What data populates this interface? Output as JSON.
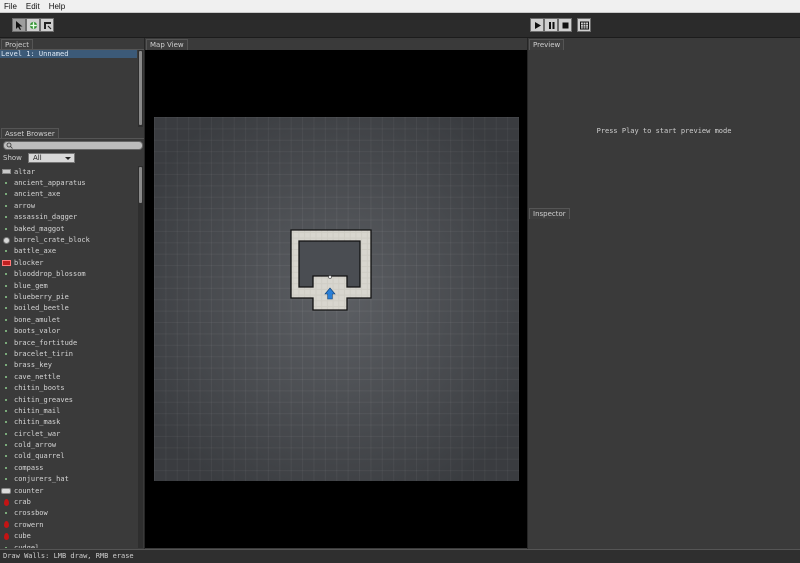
{
  "menu": [
    "File",
    "Edit",
    "Help"
  ],
  "toolbar": {
    "left_tools": [
      "select-tool",
      "add-tool",
      "draw-walls-tool"
    ],
    "playback": [
      "play",
      "pause",
      "stop",
      "export"
    ]
  },
  "project": {
    "tab_label": "Project",
    "items": [
      "Level 1: Unnamed"
    ]
  },
  "asset_browser": {
    "tab_label": "Asset Browser",
    "show_label": "Show",
    "show_value": "All",
    "items": [
      {
        "label": "altar",
        "icon": "flag-icon"
      },
      {
        "label": "ancient_apparatus",
        "icon": "dot-icon"
      },
      {
        "label": "ancient_axe",
        "icon": "dot-icon"
      },
      {
        "label": "arrow",
        "icon": "dot-icon"
      },
      {
        "label": "assassin_dagger",
        "icon": "dot-icon"
      },
      {
        "label": "baked_maggot",
        "icon": "dot-icon"
      },
      {
        "label": "barrel_crate_block",
        "icon": "crate-icon"
      },
      {
        "label": "battle_axe",
        "icon": "dot-icon"
      },
      {
        "label": "blocker",
        "icon": "blocker-icon"
      },
      {
        "label": "blooddrop_blossom",
        "icon": "dot-icon"
      },
      {
        "label": "blue_gem",
        "icon": "dot-icon"
      },
      {
        "label": "blueberry_pie",
        "icon": "dot-icon"
      },
      {
        "label": "boiled_beetle",
        "icon": "dot-icon"
      },
      {
        "label": "bone_amulet",
        "icon": "dot-icon"
      },
      {
        "label": "boots_valor",
        "icon": "dot-icon"
      },
      {
        "label": "brace_fortitude",
        "icon": "dot-icon"
      },
      {
        "label": "bracelet_tirin",
        "icon": "dot-icon"
      },
      {
        "label": "brass_key",
        "icon": "dot-icon"
      },
      {
        "label": "cave_nettle",
        "icon": "dot-icon"
      },
      {
        "label": "chitin_boots",
        "icon": "dot-icon"
      },
      {
        "label": "chitin_greaves",
        "icon": "dot-icon"
      },
      {
        "label": "chitin_mail",
        "icon": "dot-icon"
      },
      {
        "label": "chitin_mask",
        "icon": "dot-icon"
      },
      {
        "label": "circlet_war",
        "icon": "dot-icon"
      },
      {
        "label": "cold_arrow",
        "icon": "dot-icon"
      },
      {
        "label": "cold_quarrel",
        "icon": "dot-icon"
      },
      {
        "label": "compass",
        "icon": "dot-icon"
      },
      {
        "label": "conjurers_hat",
        "icon": "dot-icon"
      },
      {
        "label": "counter",
        "icon": "counter-icon"
      },
      {
        "label": "crab",
        "icon": "drop-icon"
      },
      {
        "label": "crossbow",
        "icon": "dot-icon"
      },
      {
        "label": "crowern",
        "icon": "drop-icon"
      },
      {
        "label": "cube",
        "icon": "drop-icon"
      },
      {
        "label": "cudgel",
        "icon": "dot-icon"
      }
    ]
  },
  "map_view": {
    "tab_label": "Map View"
  },
  "preview": {
    "tab_label": "Preview",
    "message": "Press Play to start preview mode"
  },
  "inspector": {
    "tab_label": "Inspector"
  },
  "status": {
    "text": "Draw Walls: LMB draw, RMB erase"
  },
  "colors": {
    "selection": "#3c5a78",
    "panel_bg": "#3a3a3a",
    "map_bg": "#000000",
    "floor": "#4a4d52",
    "wall": "#cfcdc5",
    "party_arrow": "#2a7fd6"
  }
}
